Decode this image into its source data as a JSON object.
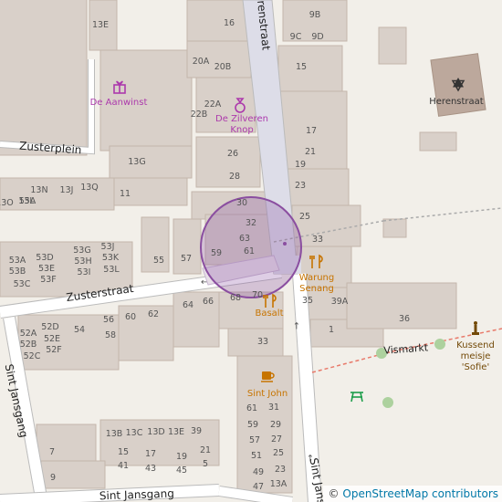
{
  "map": {
    "streets": [
      {
        "id": "herenstraat",
        "label": "Herenstraat"
      },
      {
        "id": "zusterplein",
        "label": "Zusterplein"
      },
      {
        "id": "zusterstraat",
        "label": "Zusterstraat"
      },
      {
        "id": "sint-jansgang",
        "label": "Sint Jansgang"
      },
      {
        "id": "sint-jans",
        "label": "Sint Jans"
      },
      {
        "id": "vismarkt",
        "label": "Vismarkt"
      }
    ],
    "pois": [
      {
        "id": "de-aanwinst",
        "label": "De Aanwinst",
        "icon": "gift-shop-icon",
        "color": "#ac39ac"
      },
      {
        "id": "de-zilveren-knop",
        "label": "De Zilveren Knop",
        "line1": "De Zilveren",
        "line2": "Knop",
        "icon": "jewelry-ring-icon",
        "color": "#ac39ac"
      },
      {
        "id": "herenstraat-synagogue",
        "label": "Herenstraat",
        "icon": "star-of-david-icon",
        "color": "#333333"
      },
      {
        "id": "warung-senang",
        "label": "Warung Senang",
        "line1": "Warung",
        "line2": "Senang",
        "icon": "restaurant-icon",
        "color": "#c77400"
      },
      {
        "id": "basalt",
        "label": "Basalt",
        "icon": "restaurant-icon",
        "color": "#c77400"
      },
      {
        "id": "sint-john",
        "label": "Sint John",
        "icon": "cafe-icon",
        "color": "#c77400"
      },
      {
        "id": "kussend-meisje-sofie",
        "label": "Kussend meisje 'Sofie'",
        "line1": "Kussend",
        "line2": "meisje",
        "line3": "'Sofie'",
        "icon": "statue-icon",
        "color": "#734a08"
      },
      {
        "id": "picnic-site",
        "label": "",
        "icon": "picnic-table-icon",
        "color": "#1c9d4a"
      }
    ],
    "house_numbers": [
      "16",
      "9B",
      "9C",
      "9D",
      "13E",
      "20A",
      "20B",
      "22A",
      "22B",
      "26",
      "28",
      "30",
      "32",
      "63",
      "61",
      "59",
      "57",
      "55",
      "64",
      "66",
      "68",
      "70",
      "62",
      "60",
      "56",
      "58",
      "54",
      "52A",
      "52B",
      "52C",
      "52D",
      "52E",
      "52F",
      "53A",
      "53B",
      "53C",
      "53D",
      "53E",
      "53F",
      "53G",
      "53H",
      "53I",
      "53J",
      "53K",
      "53L",
      "13G",
      "13N",
      "13L",
      "13J",
      "13Q",
      "13O",
      "55A",
      "11",
      "15",
      "17",
      "19",
      "21",
      "23",
      "25",
      "33",
      "35",
      "39A",
      "1",
      "36",
      "33",
      "61",
      "31",
      "59",
      "29",
      "57",
      "27",
      "51",
      "25",
      "49",
      "23",
      "47",
      "13A",
      "13B",
      "13C",
      "13D",
      "13E",
      "39",
      "15",
      "41",
      "17",
      "43",
      "19",
      "45",
      "21",
      "5",
      "7",
      "9"
    ],
    "highlight": {
      "label": "selected location",
      "color": "#8a4ea0"
    }
  },
  "attribution": {
    "symbol": "©",
    "text": "OpenStreetMap contributors"
  }
}
